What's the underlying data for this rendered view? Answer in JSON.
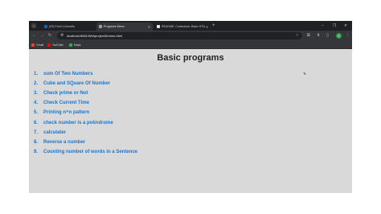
{
  "browser": {
    "tabs": [
      {
        "title": "(23) Feed | LinkedIn",
        "favicon_color": "#0a66c2",
        "active": false
      },
      {
        "title": "Programs Menu",
        "favicon_color": "#9aa0a6",
        "active": true
      },
      {
        "title": "README: Codeshare: Basic HTML",
        "favicon_color": "#e8e8e8",
        "active": false
      }
    ],
    "new_tab": "+",
    "window_controls": {
      "minimize": "–",
      "maximize": "❐",
      "close": "✕"
    },
    "url": "localhost:8081/Webproject3/menu.html",
    "avatar_letter": "S",
    "bookmarks": [
      {
        "label": "Gmail",
        "icon_color": "#ea4335"
      },
      {
        "label": "YouTube",
        "icon_color": "#ff0000"
      },
      {
        "label": "Maps",
        "icon_color": "#34a853"
      }
    ]
  },
  "page": {
    "heading": "Basic programs",
    "programs": [
      {
        "num": "1.",
        "label": "sum Of Two Numbers"
      },
      {
        "num": "2.",
        "label": "Cube and SQuare Of Number"
      },
      {
        "num": "3.",
        "label": "Check prime or Not"
      },
      {
        "num": "4.",
        "label": "Check Current Time"
      },
      {
        "num": "5.",
        "label": "Printing n^n pattern"
      },
      {
        "num": "6.",
        "label": "check number is a polindrome"
      },
      {
        "num": "7.",
        "label": "calculater"
      },
      {
        "num": "8.",
        "label": "Reverse a number"
      },
      {
        "num": "9.",
        "label": "Counting number of words in a Sentence"
      }
    ],
    "link_color": "#1f74c9"
  }
}
